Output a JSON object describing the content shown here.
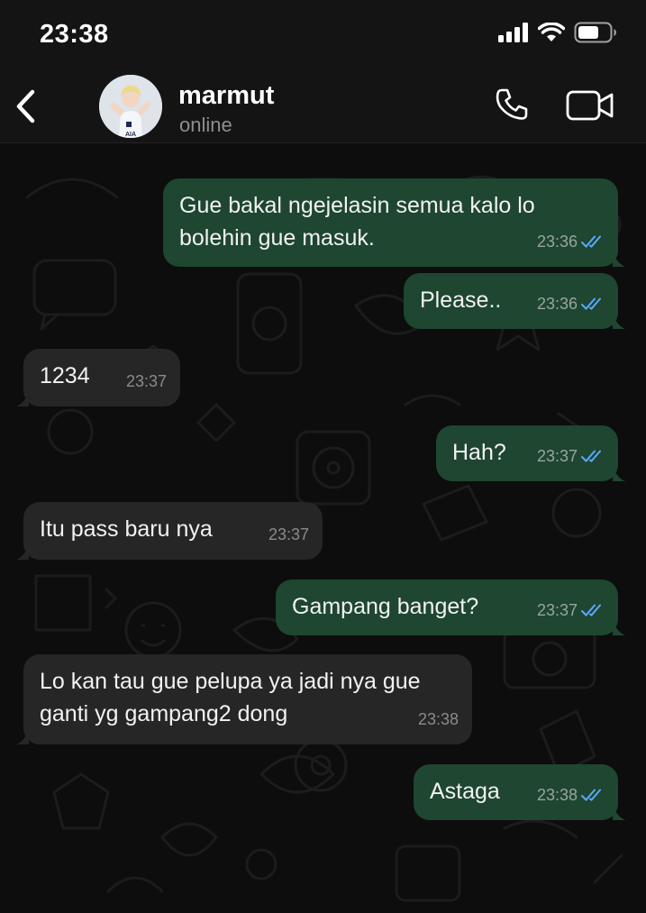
{
  "status_bar": {
    "time": "23:38"
  },
  "header": {
    "back_icon": "chevron-left-icon",
    "contact_name": "marmut",
    "contact_status": "online",
    "call_icon": "phone-icon",
    "video_icon": "video-camera-icon"
  },
  "messages": [
    {
      "direction": "out",
      "text": "Gue bakal ngejelasin semua kalo lo bolehin gue masuk.",
      "time": "23:36",
      "status": "read"
    },
    {
      "direction": "out",
      "text": "Please..",
      "time": "23:36",
      "status": "read"
    },
    {
      "direction": "in",
      "text": "1234",
      "time": "23:37"
    },
    {
      "direction": "out",
      "text": "Hah?",
      "time": "23:37",
      "status": "read"
    },
    {
      "direction": "in",
      "text": "Itu pass baru nya",
      "time": "23:37"
    },
    {
      "direction": "out",
      "text": "Gampang banget?",
      "time": "23:37",
      "status": "read"
    },
    {
      "direction": "in",
      "text": "Lo kan tau gue pelupa ya jadi nya gue ganti yg gampang2 dong",
      "time": "23:38"
    },
    {
      "direction": "out",
      "text": "Astaga",
      "time": "23:38",
      "status": "read"
    }
  ],
  "colors": {
    "outgoing_bubble": "#1e4630",
    "incoming_bubble": "#262626",
    "read_ticks": "#5aa9ff",
    "background": "#0d0d0d"
  }
}
